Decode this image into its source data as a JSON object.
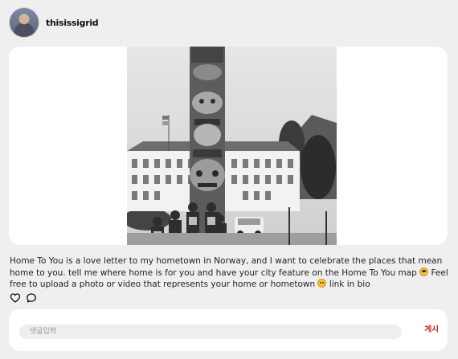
{
  "profile": {
    "username": "thisissigrid"
  },
  "post": {
    "caption_parts": {
      "part1": "Home To You is a love letter to my hometown in Norway, and I want to celebrate the places that mean home to you. tell me where home is for you and have your city feature on the Home To You map",
      "part2": "Feel free to upload a photo or video that represents your home or hometown",
      "part3": "link in bio"
    },
    "emojis": [
      "smiling-glasses-emoji",
      "heart-eyes-emoji"
    ]
  },
  "actions": {
    "like_icon": "heart-icon",
    "comment_icon": "comment-bubble-icon"
  },
  "comment": {
    "placeholder": "댓글입력",
    "post_label": "게시"
  },
  "colors": {
    "background": "#efefef",
    "card": "#ffffff",
    "post_button": "#d11f1f"
  }
}
